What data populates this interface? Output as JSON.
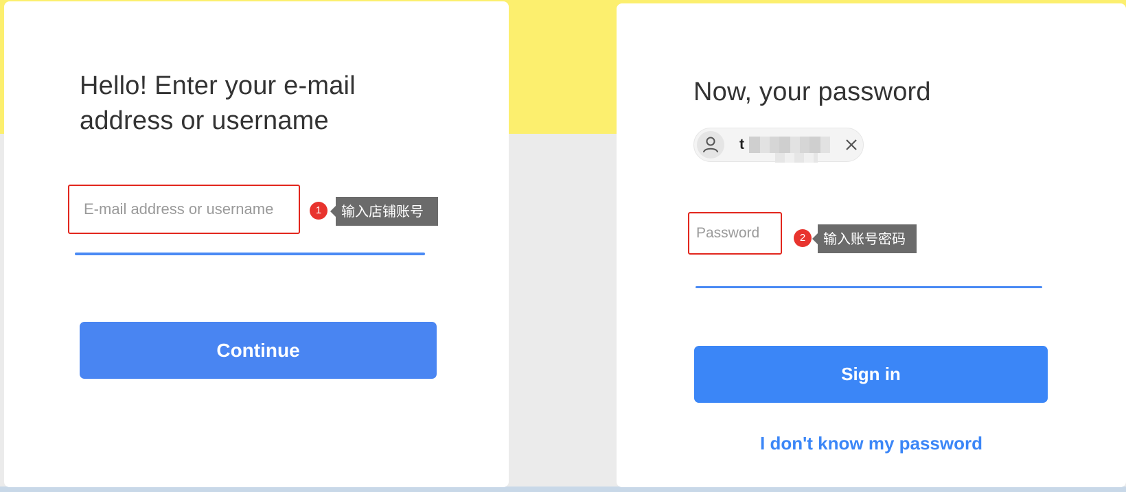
{
  "step1": {
    "heading_line1": "Hello! Enter your e-mail",
    "heading_line2": "address or username",
    "input_placeholder": "E-mail address or username",
    "marker_number": "1",
    "annotation": "输入店铺账号",
    "continue_label": "Continue"
  },
  "step2": {
    "heading": "Now, your password",
    "username_initial": "t",
    "input_placeholder": "Password",
    "marker_number": "2",
    "annotation": "输入账号密码",
    "sign_in_label": "Sign in",
    "forgot_link": "I don't know my password"
  },
  "icons": {
    "avatar": "user-icon",
    "chip_close": "close-icon"
  },
  "colors": {
    "accent_blue": "#3b86f7",
    "highlight_red": "#e2261d",
    "header_yellow": "#fcef6e",
    "tooltip_gray": "#6b6b6b"
  }
}
